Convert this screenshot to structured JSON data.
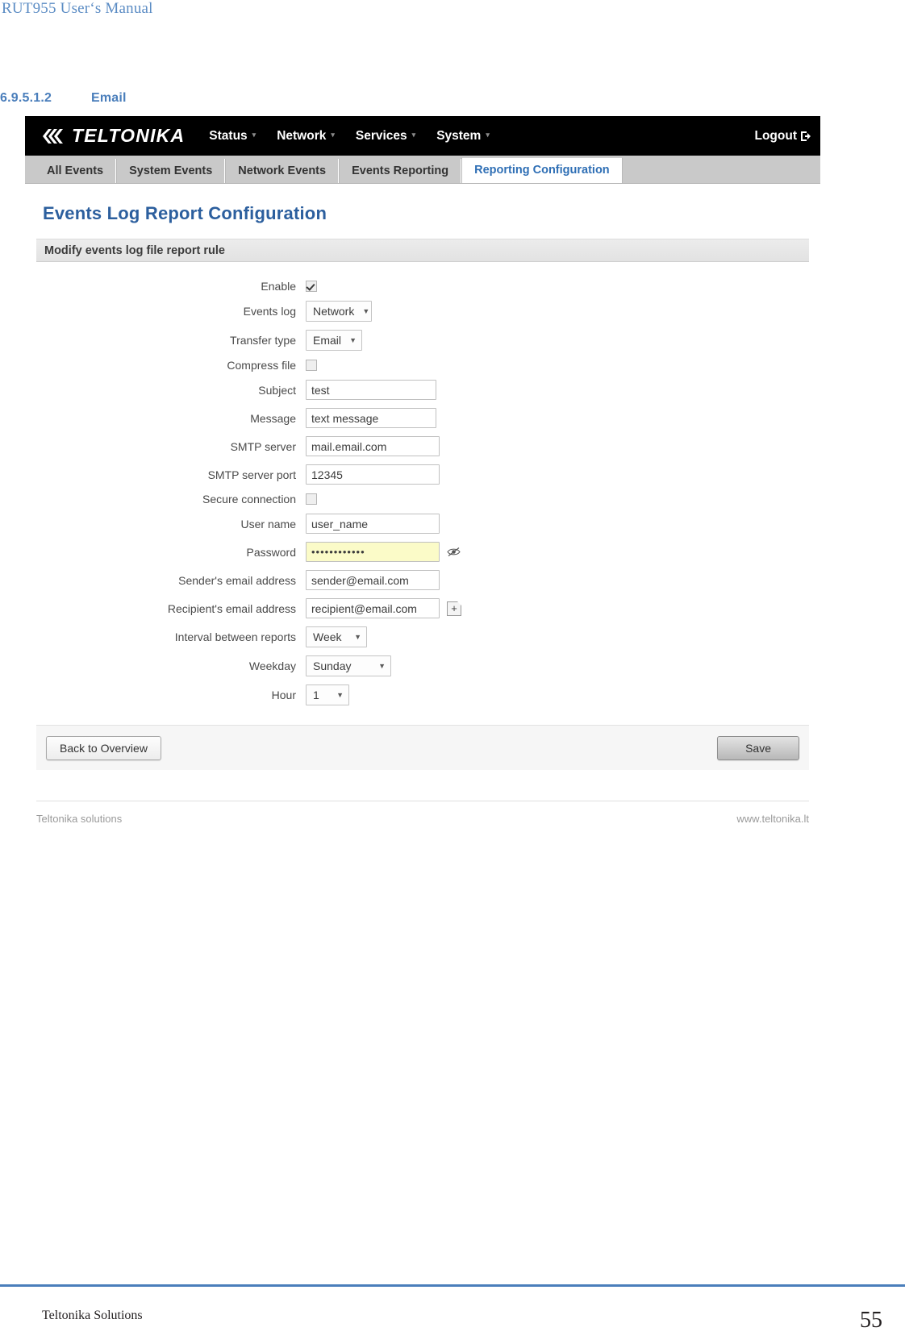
{
  "document": {
    "header_title": "RUT955 User‘s Manual",
    "section_number": "6.9.5.1.2",
    "section_title": "Email",
    "footer_left": "Teltonika Solutions",
    "footer_page": "55"
  },
  "navbar": {
    "brand": "TELTONIKA",
    "links": [
      {
        "label": "Status",
        "caret": "▾"
      },
      {
        "label": "Network",
        "caret": "▾"
      },
      {
        "label": "Services",
        "caret": "▾"
      },
      {
        "label": "System",
        "caret": "▾"
      }
    ],
    "logout": "Logout"
  },
  "tabs": [
    {
      "label": "All Events",
      "active": false
    },
    {
      "label": "System Events",
      "active": false
    },
    {
      "label": "Network Events",
      "active": false
    },
    {
      "label": "Events Reporting",
      "active": false
    },
    {
      "label": "Reporting Configuration",
      "active": true
    }
  ],
  "page": {
    "title": "Events Log Report Configuration",
    "panel_header": "Modify events log file report rule"
  },
  "form": {
    "enable": {
      "label": "Enable",
      "checked": true
    },
    "events_log": {
      "label": "Events log",
      "value": "Network"
    },
    "transfer_type": {
      "label": "Transfer type",
      "value": "Email"
    },
    "compress_file": {
      "label": "Compress file",
      "checked": false
    },
    "subject": {
      "label": "Subject",
      "value": "test"
    },
    "message": {
      "label": "Message",
      "value": "text message"
    },
    "smtp_server": {
      "label": "SMTP server",
      "value": "mail.email.com"
    },
    "smtp_server_port": {
      "label": "SMTP server port",
      "value": "12345"
    },
    "secure_connection": {
      "label": "Secure connection",
      "checked": false
    },
    "user_name": {
      "label": "User name",
      "value": "user_name"
    },
    "password": {
      "label": "Password",
      "value": "••••••••••••"
    },
    "sender_email": {
      "label": "Sender's email address",
      "value": "sender@email.com"
    },
    "recipient_email": {
      "label": "Recipient's email address",
      "value": "recipient@email.com"
    },
    "interval": {
      "label": "Interval between reports",
      "value": "Week"
    },
    "weekday": {
      "label": "Weekday",
      "value": "Sunday"
    },
    "hour": {
      "label": "Hour",
      "value": "1"
    }
  },
  "actions": {
    "back": "Back to Overview",
    "save": "Save"
  },
  "shot_footer": {
    "left": "Teltonika solutions",
    "right": "www.teltonika.lt"
  },
  "colors": {
    "accent_blue": "#4a7ebb",
    "tab_active_text": "#2f6fb5",
    "title_blue": "#2c5f9e",
    "password_bg": "#fbfbc8"
  }
}
